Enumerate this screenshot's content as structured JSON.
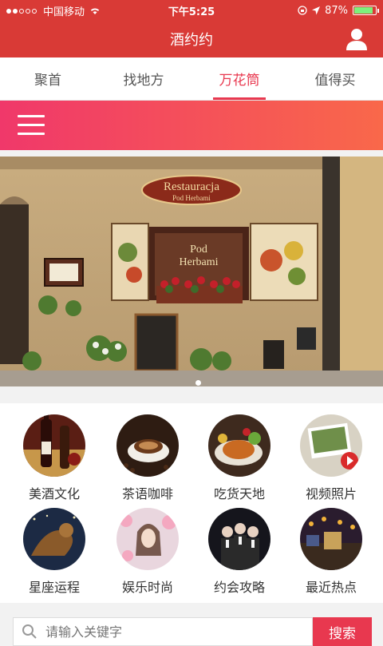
{
  "status_bar": {
    "carrier": "中国移动",
    "time": "下午5:25",
    "battery_text": "87%",
    "battery_level": 0.87
  },
  "header": {
    "title": "酒约约",
    "user_icon": "user-icon"
  },
  "tabs": [
    {
      "label": "聚首",
      "active": false
    },
    {
      "label": "找地方",
      "active": false
    },
    {
      "label": "万花筒",
      "active": true
    },
    {
      "label": "值得买",
      "active": false
    }
  ],
  "banner": {
    "sign_line1": "Restauracja",
    "sign_line2": "Pod Herbami",
    "window_text1": "Pod",
    "window_text2": "Herbami",
    "current_slide": 1
  },
  "categories": [
    {
      "label": "美酒文化",
      "icon": "wine-icon"
    },
    {
      "label": "茶语咖啡",
      "icon": "coffee-icon"
    },
    {
      "label": "吃货天地",
      "icon": "food-icon"
    },
    {
      "label": "视频照片",
      "icon": "video-photo-icon"
    },
    {
      "label": "星座运程",
      "icon": "zodiac-icon"
    },
    {
      "label": "娱乐时尚",
      "icon": "fashion-icon"
    },
    {
      "label": "约会攻略",
      "icon": "dating-icon"
    },
    {
      "label": "最近热点",
      "icon": "hotspot-icon"
    }
  ],
  "search": {
    "placeholder": "请输入关键字",
    "button_label": "搜索"
  },
  "colors": {
    "primary_red": "#d93a36",
    "accent_pink": "#e8384f",
    "gradient_start": "#f0386a",
    "gradient_end": "#f9684a"
  }
}
